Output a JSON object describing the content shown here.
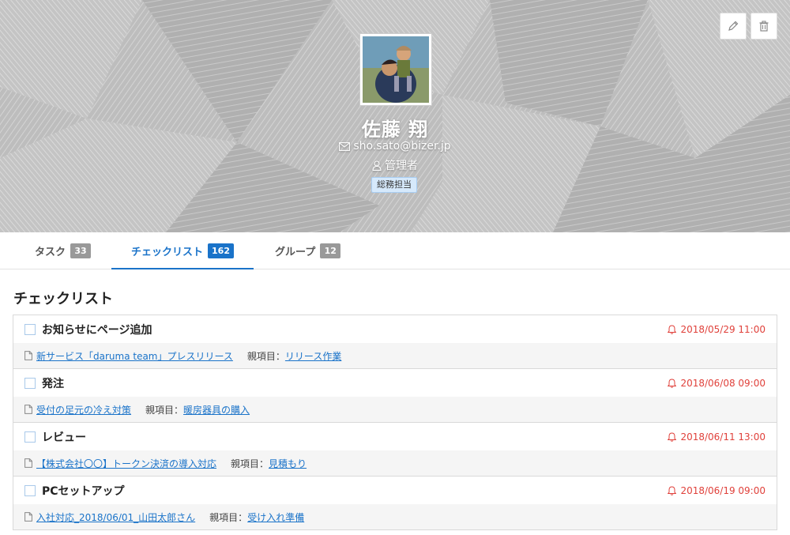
{
  "profile": {
    "name": "佐藤 翔",
    "email": "sho.sato@bizer.jp",
    "role": "管理者",
    "department": "総務担当"
  },
  "header_icons": {
    "edit": "pencil-icon",
    "delete": "trash-icon"
  },
  "tabs": [
    {
      "label": "タスク",
      "count": "33"
    },
    {
      "label": "チェックリスト",
      "count": "162"
    },
    {
      "label": "グループ",
      "count": "12"
    }
  ],
  "active_tab": "チェックリスト",
  "section_title": "チェックリスト",
  "colors": {
    "accent": "#1a73c9",
    "due": "#e0413b",
    "badge_gray": "#999999"
  },
  "checklist": [
    {
      "title": "お知らせにページ追加",
      "due": "2018/05/29 11:00",
      "task": "新サービス「daruma team」プレスリリース",
      "parent_label": "親項目：",
      "parent": "リリース作業"
    },
    {
      "title": "発注",
      "due": "2018/06/08 09:00",
      "task": "受付の足元の冷え対策",
      "parent_label": "親項目：",
      "parent": "暖房器具の購入"
    },
    {
      "title": "レビュー",
      "due": "2018/06/11 13:00",
      "task": "【株式会社〇〇】トークン決済の導入対応",
      "parent_label": "親項目：",
      "parent": "見積もり"
    },
    {
      "title": "PCセットアップ",
      "due": "2018/06/19 09:00",
      "task": "入社対応_2018/06/01_山田太郎さん",
      "parent_label": "親項目：",
      "parent": "受け入れ準備"
    }
  ]
}
